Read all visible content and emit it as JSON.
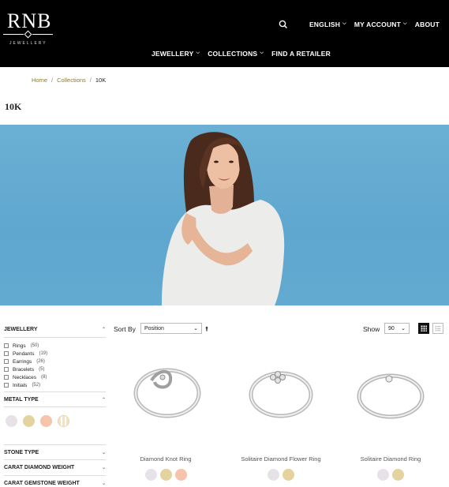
{
  "header": {
    "logo_text": "RNB",
    "logo_sub": "JEWELLERY",
    "top_nav": [
      {
        "label": "ENGLISH",
        "has_menu": true
      },
      {
        "label": "MY ACCOUNT",
        "has_menu": true
      },
      {
        "label": "ABOUT",
        "has_menu": false
      }
    ],
    "main_nav": [
      {
        "label": "JEWELLERY",
        "has_menu": true
      },
      {
        "label": "COLLECTIONS",
        "has_menu": true
      },
      {
        "label": "FIND A RETAILER",
        "has_menu": false
      }
    ]
  },
  "breadcrumb": {
    "items": [
      "Home",
      "Collections"
    ],
    "separator": "/",
    "current": "10K"
  },
  "page_title": "10K",
  "filters": {
    "jewellery": {
      "title": "JEWELLERY",
      "options": [
        {
          "label": "Rings",
          "count": "(50)"
        },
        {
          "label": "Pendants",
          "count": "(19)"
        },
        {
          "label": "Earrings",
          "count": "(26)"
        },
        {
          "label": "Bracelets",
          "count": "(5)"
        },
        {
          "label": "Necklaces",
          "count": "(8)"
        },
        {
          "label": "Initials",
          "count": "(52)"
        }
      ]
    },
    "metal_type": {
      "title": "METAL TYPE"
    },
    "stone_type": {
      "title": "STONE TYPE"
    },
    "carat_diamond": {
      "title": "CARAT DIAMOND WEIGHT"
    },
    "carat_gemstone": {
      "title": "CARAT GEMSTONE WEIGHT"
    }
  },
  "toolbar": {
    "sort_label": "Sort By",
    "sort_value": "Position",
    "show_label": "Show",
    "show_value": "90"
  },
  "products": [
    {
      "name": "Diamond Knot Ring",
      "swatches": [
        "white",
        "yellow",
        "rose"
      ]
    },
    {
      "name": "Solitaire Diamond Flower Ring",
      "swatches": [
        "white",
        "yellow"
      ]
    },
    {
      "name": "Solitaire Diamond Ring",
      "swatches": [
        "white",
        "yellow"
      ]
    }
  ],
  "colors": {
    "header_bg": "#000000",
    "breadcrumb_link": "#8a7a3c",
    "hero_bg": "#63aad0",
    "metal_white": "#e7e2e8",
    "metal_yellow": "#e4d39e",
    "metal_rose": "#f6c3ab"
  }
}
